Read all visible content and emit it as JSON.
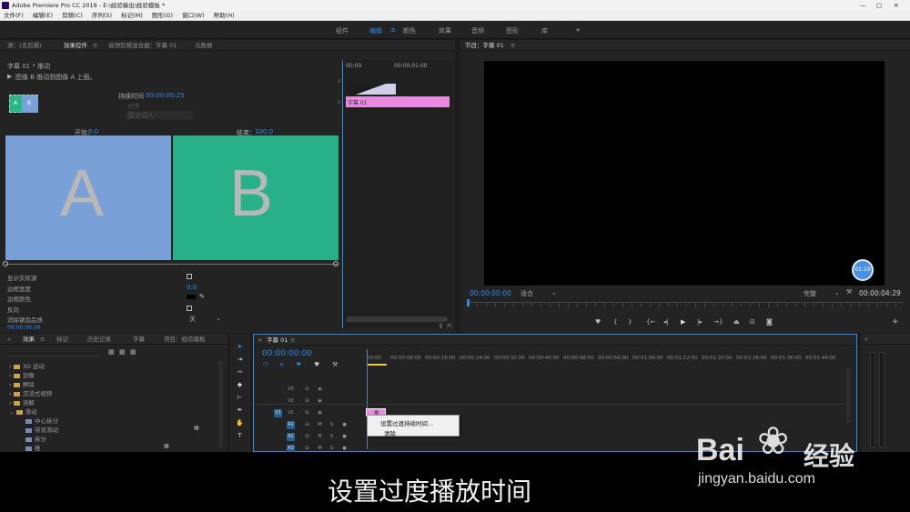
{
  "app": {
    "title": "Adobe Premiere Pro CC 2018 - E:\\经验输出\\经验模板 *",
    "window_controls": [
      "—",
      "□",
      "✕"
    ]
  },
  "menu": [
    "文件(F)",
    "编辑(E)",
    "剪辑(C)",
    "序列(S)",
    "标记(M)",
    "图形(G)",
    "窗口(W)",
    "帮助(H)"
  ],
  "workspaces": [
    "组件",
    "编辑",
    "颜色",
    "效果",
    "音频",
    "图形",
    "库"
  ],
  "effect_controls": {
    "tabs": [
      "源：(无剪辑)",
      "效果控件",
      "音频剪辑混合器：字幕 01",
      "元数据"
    ],
    "clip_label": "字幕 01 * 推动",
    "description": "图像 B 推动到图像 A 上面。",
    "duration_label": "持续时间",
    "duration_value": "00:00:00:25",
    "align_label": "对齐",
    "align_value": "起点切入",
    "start_label": "开始：",
    "start_value": "0.0",
    "end_label": "结束：",
    "end_value": "100.0",
    "preview_a": "A",
    "preview_b": "B",
    "thumb_a": "A",
    "thumb_b": "B",
    "props": [
      {
        "label": "显示实际源",
        "type": "checkbox"
      },
      {
        "label": "边框宽度",
        "value": "0.0"
      },
      {
        "label": "边框颜色",
        "type": "color"
      },
      {
        "label": "反向",
        "type": "checkbox"
      },
      {
        "label": "消除锯齿品质",
        "value": "关"
      }
    ],
    "timecode": "00:00:00:00",
    "mini_timeline_start": "00:00",
    "mini_timeline_end": "00:00:01:00",
    "track_a": "A",
    "track_b": "B",
    "clip_name": "字幕 01"
  },
  "program": {
    "title": "节目：字幕 01",
    "timecode": "00:00:00:00",
    "fit": "适合",
    "quality": "完整",
    "duration": "00:00:04:29",
    "badge": "01:19"
  },
  "project": {
    "tabs": [
      "效果",
      "标记",
      "历史记录",
      "字幕",
      "项目：经验模板"
    ],
    "tree": [
      "3D 运动",
      "划像",
      "擦除",
      "沉浸式视频",
      "溶解",
      "滑动",
      "中心拆分",
      "带状滑动",
      "拆分",
      "推"
    ]
  },
  "sequence": {
    "tab": "字幕 01",
    "timecode": "00:00:00:00",
    "ruler": [
      "00:00",
      "00:00:08:00",
      "00:00:16:00",
      "00:00:24:00",
      "00:00:32:00",
      "00:00:40:00",
      "00:00:48:00",
      "00:00:56:00",
      "00:01:04:00",
      "00:01:12:00",
      "00:01:20:00",
      "00:01:28:00",
      "00:01:36:00",
      "00:01:44:00"
    ],
    "tracks": [
      {
        "name": "V3",
        "type": "video"
      },
      {
        "name": "V2",
        "type": "video"
      },
      {
        "name": "V1",
        "type": "video",
        "active": true
      },
      {
        "name": "A1",
        "type": "audio",
        "active": true
      },
      {
        "name": "A2",
        "type": "audio",
        "active": true
      },
      {
        "name": "A3",
        "type": "audio",
        "active": true
      }
    ],
    "clip_text": "推",
    "context_menu": [
      "设置过渡持续时间...",
      "清除"
    ]
  },
  "caption": "设置过度播放时间",
  "watermark": {
    "brand": "Bai",
    "brand_cn": "经验",
    "url": "jingyan.baidu.com"
  },
  "colors": {
    "accent_blue": "#2d8ceb",
    "pink_clip": "#e88be0",
    "a_blue": "#7aa0d8",
    "b_green": "#28b088",
    "selected_track": "#2a5f8f"
  }
}
